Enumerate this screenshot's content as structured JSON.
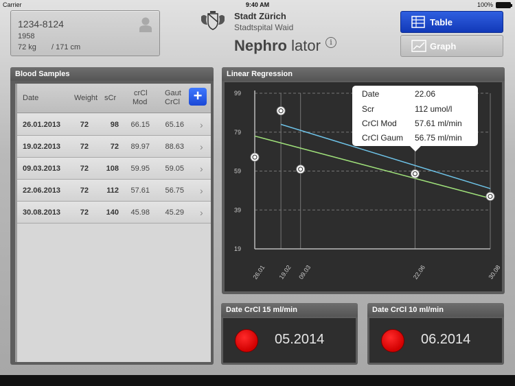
{
  "status_bar": {
    "carrier": "Carrier",
    "time": "9:40 AM",
    "battery": "100%"
  },
  "patient": {
    "id": "1234-8124",
    "year": "1958",
    "weight": "72 kg",
    "height": "/  171 cm"
  },
  "header": {
    "city": "Stadt Zürich",
    "hospital": "Stadtspital Waid",
    "title_bold": "Nephro",
    "title_rest": "lator",
    "info": "i"
  },
  "view_toggle": {
    "table_label": "Table",
    "graph_label": "Graph",
    "selected": "Table",
    "accent": "#1e49d0"
  },
  "blood_samples": {
    "title": "Blood Samples",
    "columns": {
      "date": "Date",
      "weight": "Weight",
      "scr": "sCr",
      "crcl_mod_1": "crCl",
      "crcl_mod_2": "Mod",
      "gaut_1": "Gaut",
      "gaut_2": "CrCl"
    },
    "add_label": "+",
    "rows": [
      {
        "date": "26.01.2013",
        "weight": "72",
        "scr": "98",
        "mod": "66.15",
        "gaut": "65.16"
      },
      {
        "date": "19.02.2013",
        "weight": "72",
        "scr": "72",
        "mod": "89.97",
        "gaut": "88.63"
      },
      {
        "date": "09.03.2013",
        "weight": "72",
        "scr": "108",
        "mod": "59.95",
        "gaut": "59.05"
      },
      {
        "date": "22.06.2013",
        "weight": "72",
        "scr": "112",
        "mod": "57.61",
        "gaut": "56.75"
      },
      {
        "date": "30.08.2013",
        "weight": "72",
        "scr": "140",
        "mod": "45.98",
        "gaut": "45.29"
      }
    ]
  },
  "chart_panel": {
    "title": "Linear Regression"
  },
  "tooltip": {
    "rows": [
      {
        "label": "Date",
        "value": "22.06"
      },
      {
        "label": "Scr",
        "value": "112 umol/l"
      },
      {
        "label": "CrCl Mod",
        "value": "57.61 ml/min"
      },
      {
        "label": "CrCl Gaum",
        "value": "56.75 ml/min"
      }
    ]
  },
  "chart_data": {
    "type": "scatter",
    "title": "",
    "xlabel": "",
    "ylabel": "",
    "x_tick_labels": [
      "26.01",
      "19.02",
      "09.03",
      "22.06",
      "30.08"
    ],
    "x_day_of_year": [
      26,
      50,
      68,
      173,
      242
    ],
    "y_ticks": [
      19,
      39,
      59,
      79,
      99
    ],
    "ylim": [
      19,
      99
    ],
    "xlim": [
      26,
      242
    ],
    "points": [
      {
        "x": "26.01",
        "y": 66.15
      },
      {
        "x": "19.02",
        "y": 89.97
      },
      {
        "x": "09.03",
        "y": 59.95
      },
      {
        "x": "22.06",
        "y": 57.61
      },
      {
        "x": "30.08",
        "y": 45.98
      }
    ],
    "series": [
      {
        "values": [
          [
            50,
            83
          ],
          [
            242,
            50
          ]
        ],
        "color": "#6ec3e8"
      },
      {
        "values": [
          [
            26,
            77
          ],
          [
            242,
            45
          ]
        ],
        "color": "#9fe07a"
      }
    ],
    "grid": true
  },
  "crcl15": {
    "title": "Date CrCl 15 ml/min",
    "date": "05.2014",
    "status_color": "#e00000"
  },
  "crcl10": {
    "title": "Date CrCl 10 ml/min",
    "date": "06.2014",
    "status_color": "#e00000"
  }
}
